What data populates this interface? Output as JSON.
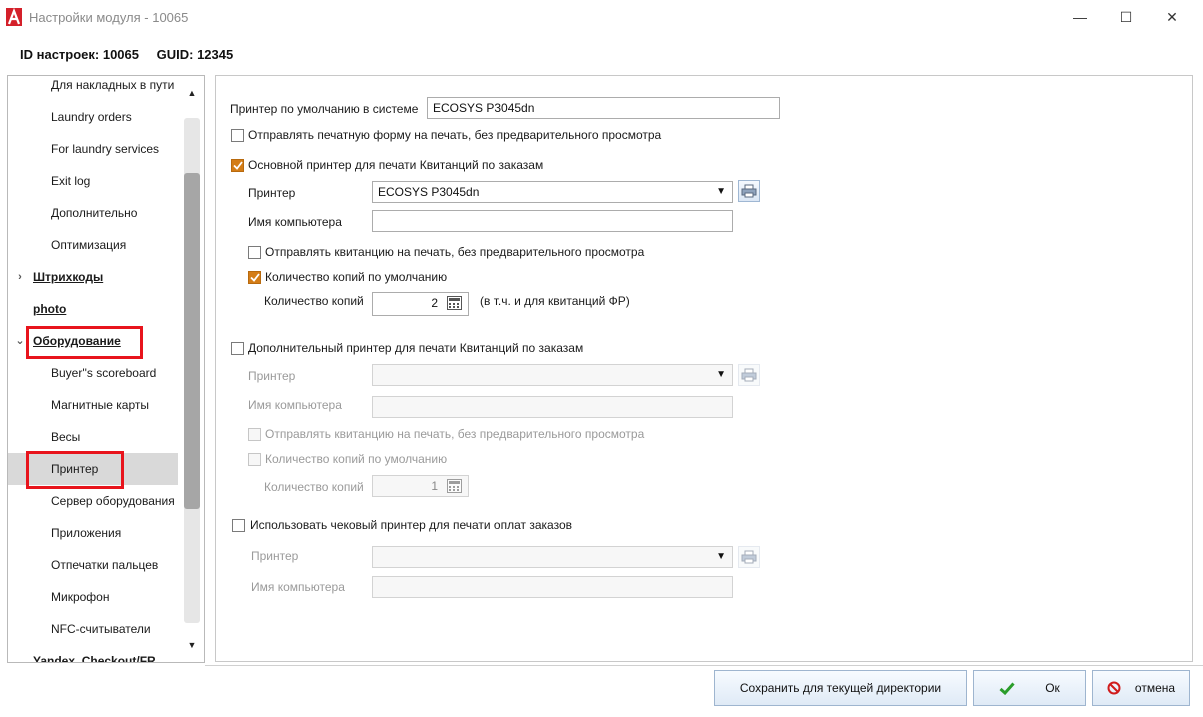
{
  "window": {
    "title": "Настройки модуля - 10065",
    "minimize_glyph": "—",
    "maximize_glyph": "☐",
    "close_glyph": "✕"
  },
  "header": {
    "settings_id": "ID настроек: 10065",
    "guid": "GUID: 12345"
  },
  "tree": {
    "items": [
      {
        "label": "Для накладных в пути"
      },
      {
        "label": "Laundry orders"
      },
      {
        "label": "For laundry services"
      },
      {
        "label": "Exit log"
      },
      {
        "label": "Дополнительно"
      },
      {
        "label": "Оптимизация"
      },
      {
        "label": "Штрихкоды",
        "expander": "›"
      },
      {
        "label": "photo"
      },
      {
        "label": "Оборудование",
        "expander": "⌄"
      },
      {
        "label": "Buyer''s scoreboard"
      },
      {
        "label": "Магнитные карты"
      },
      {
        "label": "Весы"
      },
      {
        "label": "Принтер"
      },
      {
        "label": "Сервер оборудования"
      },
      {
        "label": "Приложения"
      },
      {
        "label": "Отпечатки пальцев"
      },
      {
        "label": "Микрофон"
      },
      {
        "label": "NFC-считыватели"
      },
      {
        "label": "Yandex_Checkout/FR"
      }
    ],
    "selected": "Принтер",
    "scroll_up": "▲",
    "scroll_down": "▼"
  },
  "form": {
    "default_printer_label": "Принтер по умолчанию в системе",
    "default_printer_value": "ECOSYS P3045dn",
    "send_print_form_no_preview": "Отправлять печатную форму на печать, без предварительного просмотра",
    "main_printer": {
      "checkbox_label": "Основной принтер для печати Квитанций по заказам",
      "checked": true,
      "printer_label": "Принтер",
      "printer_value": "ECOSYS P3045dn",
      "computer_label": "Имя компьютера",
      "computer_value": "",
      "send_no_preview": "Отправлять квитанцию на печать, без предварительного просмотра",
      "send_no_preview_checked": false,
      "default_copies": "Количество копий по умолчанию",
      "default_copies_checked": true,
      "copies_label": "Количество копий",
      "copies_value": "2",
      "copies_note": "(в т.ч. и для квитанций ФР)"
    },
    "extra_printer": {
      "checkbox_label": "Дополнительный принтер для печати Квитанций по заказам",
      "checked": false,
      "printer_label": "Принтер",
      "printer_value": "",
      "computer_label": "Имя компьютера",
      "computer_value": "",
      "send_no_preview": "Отправлять квитанцию на печать, без предварительного просмотра",
      "default_copies": "Количество копий по умолчанию",
      "copies_label": "Количество копий",
      "copies_value": "1"
    },
    "receipt_printer": {
      "checkbox_label": "Использовать чековый принтер для печати оплат заказов",
      "checked": false,
      "printer_label": "Принтер",
      "printer_value": "",
      "computer_label": "Имя компьютера",
      "computer_value": ""
    }
  },
  "footer": {
    "save_dir_label": "Сохранить для текущей директории",
    "ok_label": "Ок",
    "cancel_label": "отмена"
  },
  "colors": {
    "checkbox_checked": "#d47d17",
    "highlight_box": "#e8141c",
    "ok_icon": "#2a9d2a",
    "cancel_icon": "#d11c1c",
    "logo": "#d4202a"
  },
  "icons": {
    "app_logo": "app-logo-icon",
    "printer": "printer-icon",
    "calculator": "calculator-icon",
    "ok": "checkmark-icon",
    "cancel": "no-entry-icon"
  }
}
